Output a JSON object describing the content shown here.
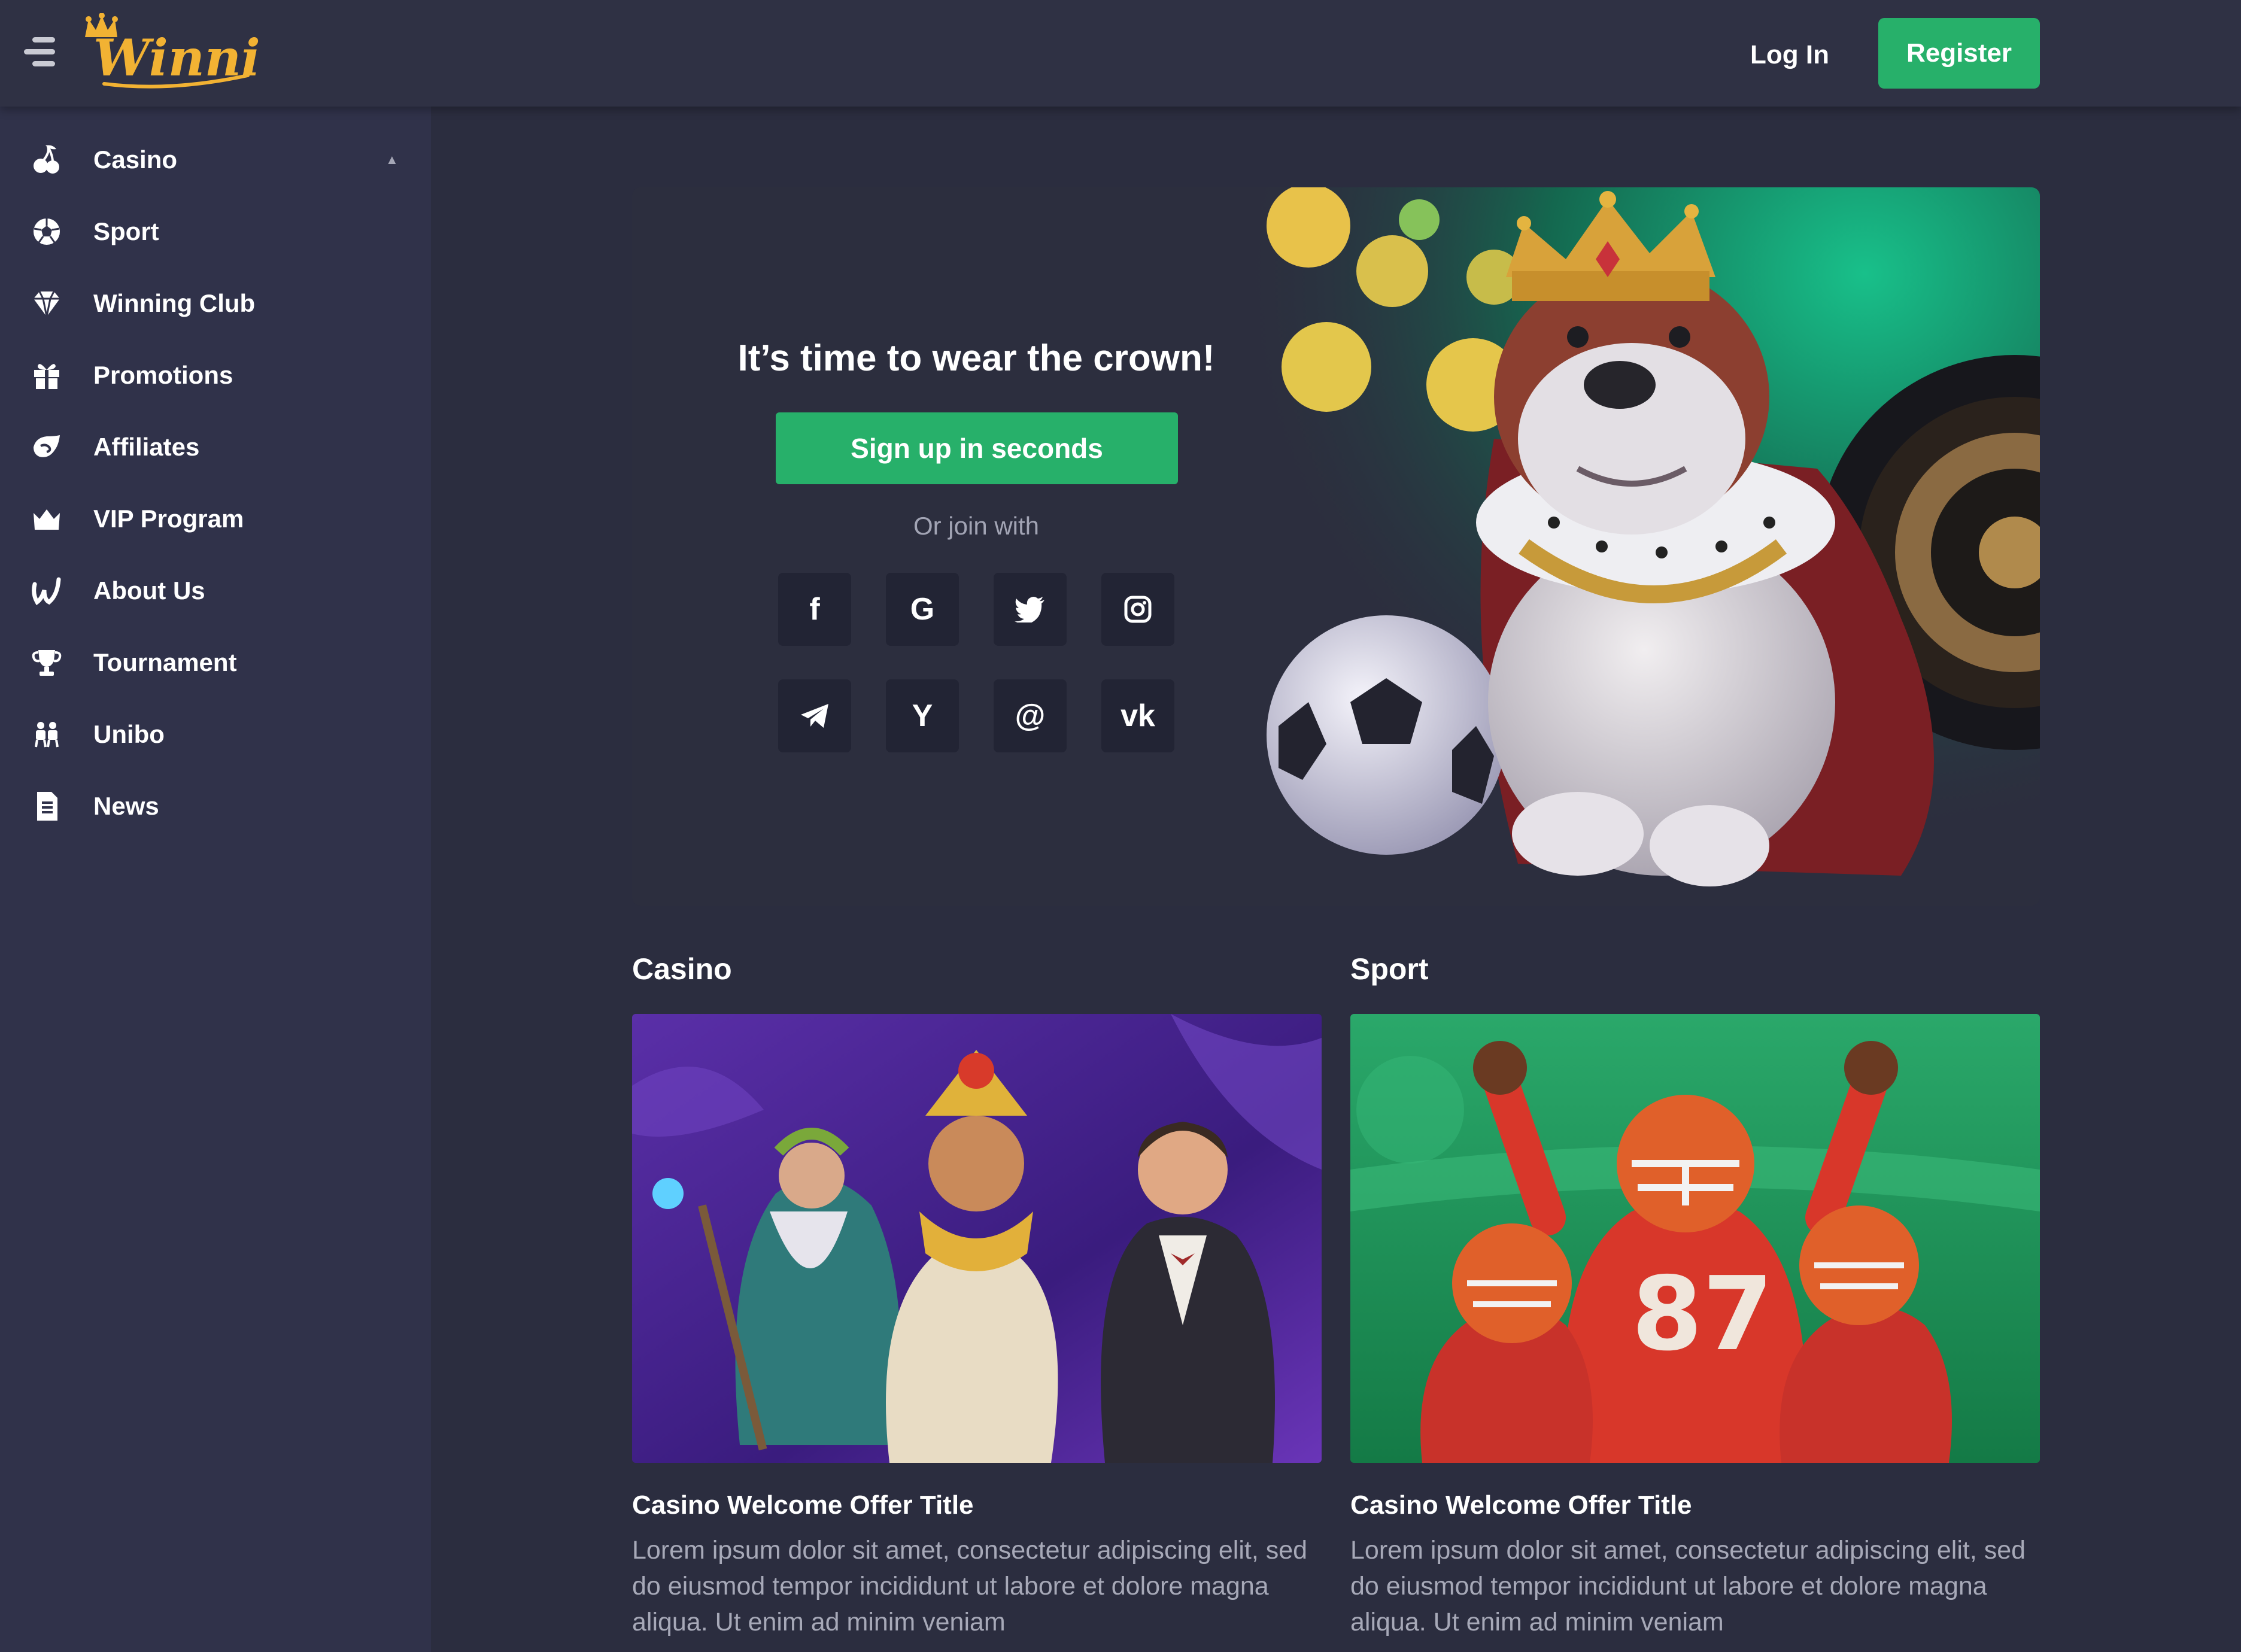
{
  "header": {
    "logo_text": "Winning",
    "login_label": "Log In",
    "register_label": "Register"
  },
  "sidebar": {
    "items": [
      {
        "label": "Casino",
        "icon": "cherries-icon",
        "expanded": true
      },
      {
        "label": "Sport",
        "icon": "soccer-ball-icon"
      },
      {
        "label": "Winning Club",
        "icon": "diamond-icon"
      },
      {
        "label": "Promotions",
        "icon": "gift-icon"
      },
      {
        "label": "Affiliates",
        "icon": "handshake-icon"
      },
      {
        "label": "VIP Program",
        "icon": "crown-icon"
      },
      {
        "label": "About Us",
        "icon": "winning-w-icon"
      },
      {
        "label": "Tournament",
        "icon": "trophy-icon"
      },
      {
        "label": "Unibo",
        "icon": "unibo-icon"
      },
      {
        "label": "News",
        "icon": "document-icon"
      }
    ]
  },
  "hero": {
    "title": "It’s time to wear the crown!",
    "signup_label": "Sign up in seconds",
    "join_text": "Or join with",
    "socials": [
      {
        "name": "facebook",
        "glyph": "f"
      },
      {
        "name": "google",
        "glyph": "G"
      },
      {
        "name": "twitter",
        "glyph": ""
      },
      {
        "name": "instagram",
        "glyph": ""
      },
      {
        "name": "telegram",
        "glyph": ""
      },
      {
        "name": "yandex",
        "glyph": "Y"
      },
      {
        "name": "mail",
        "glyph": "@"
      },
      {
        "name": "vk",
        "glyph": "vk"
      }
    ]
  },
  "sections": [
    {
      "heading": "Casino",
      "card_title": "Casino Welcome Offer Title",
      "card_text": "Lorem ipsum dolor sit amet, consectetur adipiscing elit, sed do eiusmod tempor incididunt ut labore et dolore magna aliqua. Ut enim ad minim veniam"
    },
    {
      "heading": "Sport",
      "card_title": "Casino Welcome Offer Title",
      "card_text": "Lorem ipsum dolor sit amet, consectetur adipiscing elit, sed do eiusmod tempor incididunt ut labore et dolore magna aliqua. Ut enim ad minim veniam"
    }
  ],
  "colors": {
    "accent_green": "#27b06a",
    "logo_gold": "#f2b233",
    "background": "#2b2d3f",
    "sidebar": "#30324a"
  }
}
